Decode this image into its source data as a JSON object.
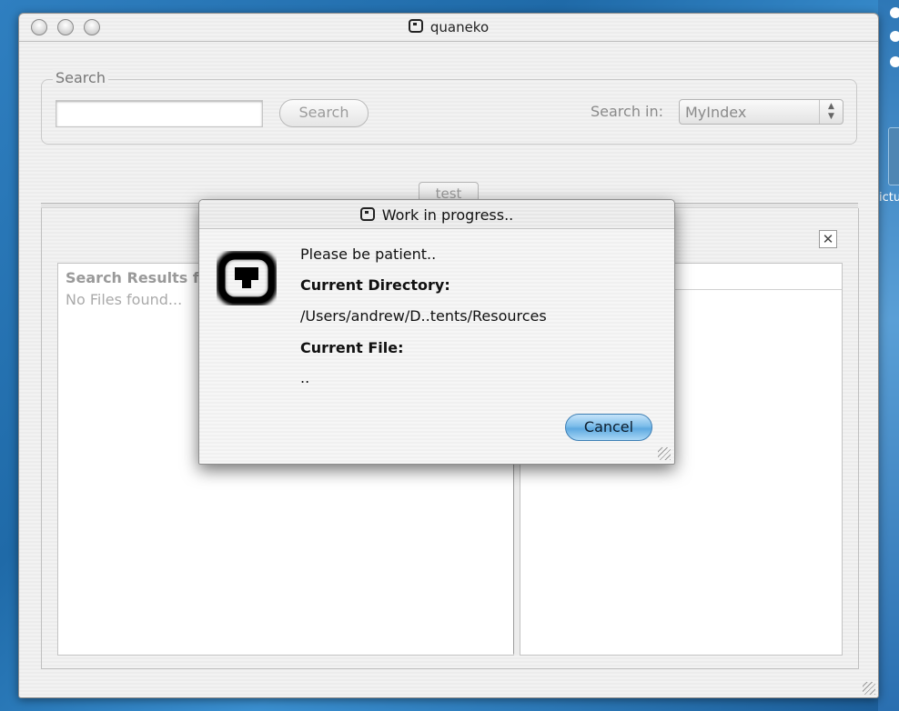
{
  "window": {
    "title": "quaneko"
  },
  "search": {
    "group_label": "Search",
    "input_value": "",
    "button_label": "Search",
    "search_in_label": "Search in:",
    "search_in_value": "MyIndex"
  },
  "tabs": [
    {
      "label": "test"
    }
  ],
  "results": {
    "header": "Search Results f",
    "empty_text": "No Files found..."
  },
  "dialog": {
    "title": "Work in progress..",
    "message": "Please be patient..",
    "current_directory_label": "Current Directory:",
    "current_directory_value": "/Users/andrew/D..tents/Resources",
    "current_file_label": "Current File:",
    "current_file_value": "..",
    "cancel_label": "Cancel"
  },
  "desktop": {
    "icon_label": "ictu"
  },
  "colors": {
    "desktop_blue": "#2f7fc0",
    "aqua_button": "#5ea9e0",
    "window_bg": "#efefef"
  }
}
